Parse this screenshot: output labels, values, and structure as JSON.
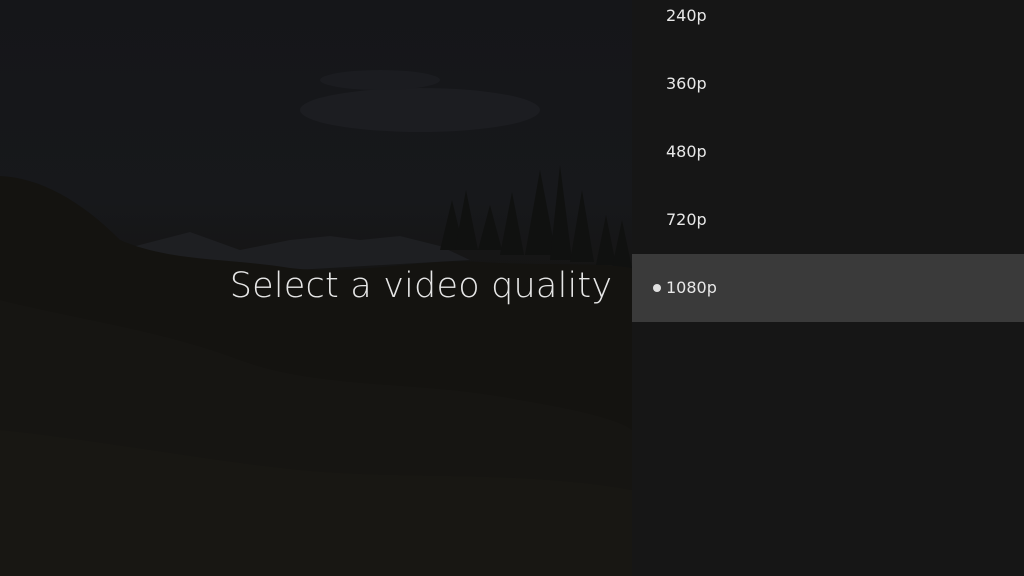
{
  "dialog": {
    "title": "Select a video quality"
  },
  "quality_options": [
    {
      "label": "240p",
      "selected": false
    },
    {
      "label": "360p",
      "selected": false
    },
    {
      "label": "480p",
      "selected": false
    },
    {
      "label": "720p",
      "selected": false
    },
    {
      "label": "1080p",
      "selected": true
    }
  ],
  "icons": {
    "selected_indicator": "radio-dot-icon"
  },
  "colors": {
    "panel_background": "#161616",
    "selected_row": "#3a3a3a",
    "text": "#e8e8e8"
  }
}
